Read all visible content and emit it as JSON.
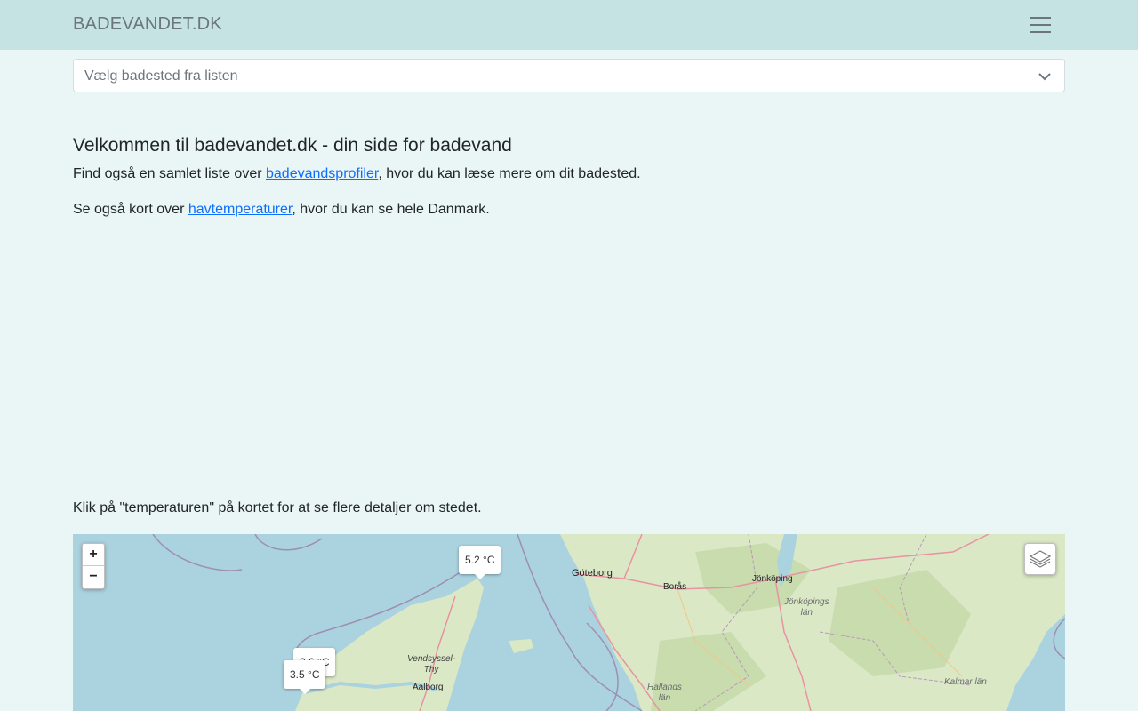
{
  "header": {
    "brand": "BADEVANDET.DK"
  },
  "select": {
    "placeholder": "Vælg badested fra listen"
  },
  "intro": {
    "title": "Velkommen til badevandet.dk - din side for badevand",
    "p1_before": "Find også en samlet liste over ",
    "p1_link": "badevandsprofiler",
    "p1_after": ", hvor du kan læse mere om dit badested.",
    "p2_before": "Se også kort over ",
    "p2_link": "havtemperaturer",
    "p2_after": ", hvor du kan se hele Danmark.",
    "map_hint": "Klik på \"temperaturen\" på kortet for at se flere detaljer om stedet."
  },
  "map": {
    "zoom_in": "+",
    "zoom_out": "−",
    "markers": [
      "5.2 °C",
      "3.6 °C",
      "3.5 °C"
    ],
    "places": {
      "goteborg": "Göteborg",
      "boras": "Borås",
      "jonkoping": "Jönköping",
      "jonkopings_lan_1": "Jönköpings",
      "jonkopings_lan_2": "län",
      "vendsyssel_1": "Vendsyssel-",
      "vendsyssel_2": "Thy",
      "aalborg": "Aalborg",
      "hallands_1": "Hallands",
      "hallands_2": "län",
      "kalmar": "Kalmar län"
    },
    "colors": {
      "water": "#aad3df",
      "land": "#dbe8c6",
      "forest": "#c8dcae",
      "road": "#e892a2",
      "boundary": "#9e8fb0"
    }
  }
}
